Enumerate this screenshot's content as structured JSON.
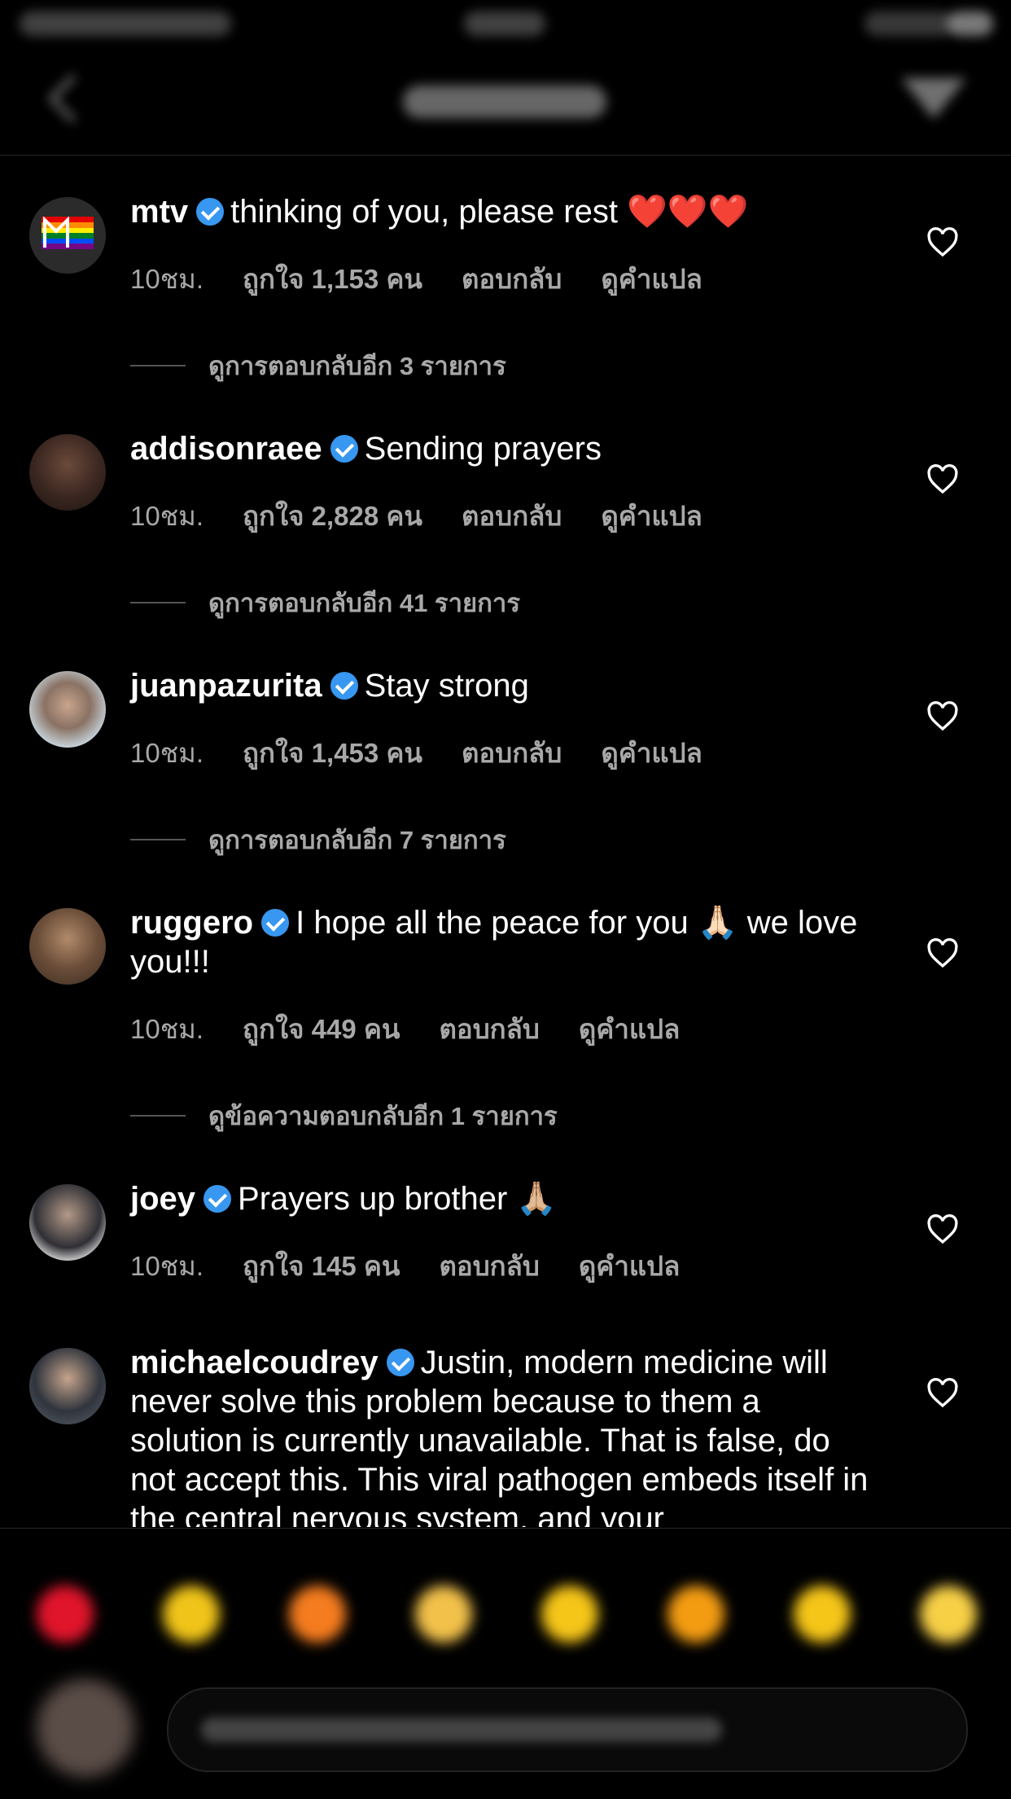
{
  "comments": [
    {
      "username": "mtv",
      "text": "thinking of you, please rest",
      "emoji": "❤️❤️❤️",
      "time": "10ชม.",
      "likes": "ถูกใจ 1,153 คน",
      "reply": "ตอบกลับ",
      "translate": "ดูคำแปล",
      "more_replies": "ดูการตอบกลับอีก 3 รายการ"
    },
    {
      "username": "addisonraee",
      "text": "Sending prayers",
      "time": "10ชม.",
      "likes": "ถูกใจ 2,828 คน",
      "reply": "ตอบกลับ",
      "translate": "ดูคำแปล",
      "more_replies": "ดูการตอบกลับอีก 41 รายการ"
    },
    {
      "username": "juanpazurita",
      "text": "Stay strong",
      "time": "10ชม.",
      "likes": "ถูกใจ 1,453 คน",
      "reply": "ตอบกลับ",
      "translate": "ดูคำแปล",
      "more_replies": "ดูการตอบกลับอีก 7 รายการ"
    },
    {
      "username": "ruggero",
      "text": "I hope all the peace for you 🙏🏻 we love you!!!",
      "time": "10ชม.",
      "likes": "ถูกใจ 449 คน",
      "reply": "ตอบกลับ",
      "translate": "ดูคำแปล",
      "more_replies": "ดูข้อความตอบกลับอีก 1 รายการ"
    },
    {
      "username": "joey",
      "text": "Prayers up brother 🙏🏼",
      "time": "10ชม.",
      "likes": "ถูกใจ 145 คน",
      "reply": "ตอบกลับ",
      "translate": "ดูคำแปล"
    },
    {
      "username": "michaelcoudrey",
      "text": "Justin, modern medicine will never solve this problem because to them a solution is currently unavailable. That is false, do not accept this. This viral pathogen embeds itself in the central nervous system, and your"
    }
  ],
  "colors": {
    "background": "#000000",
    "meta_text": "#a8a8a8",
    "verified": "#3897f0"
  }
}
